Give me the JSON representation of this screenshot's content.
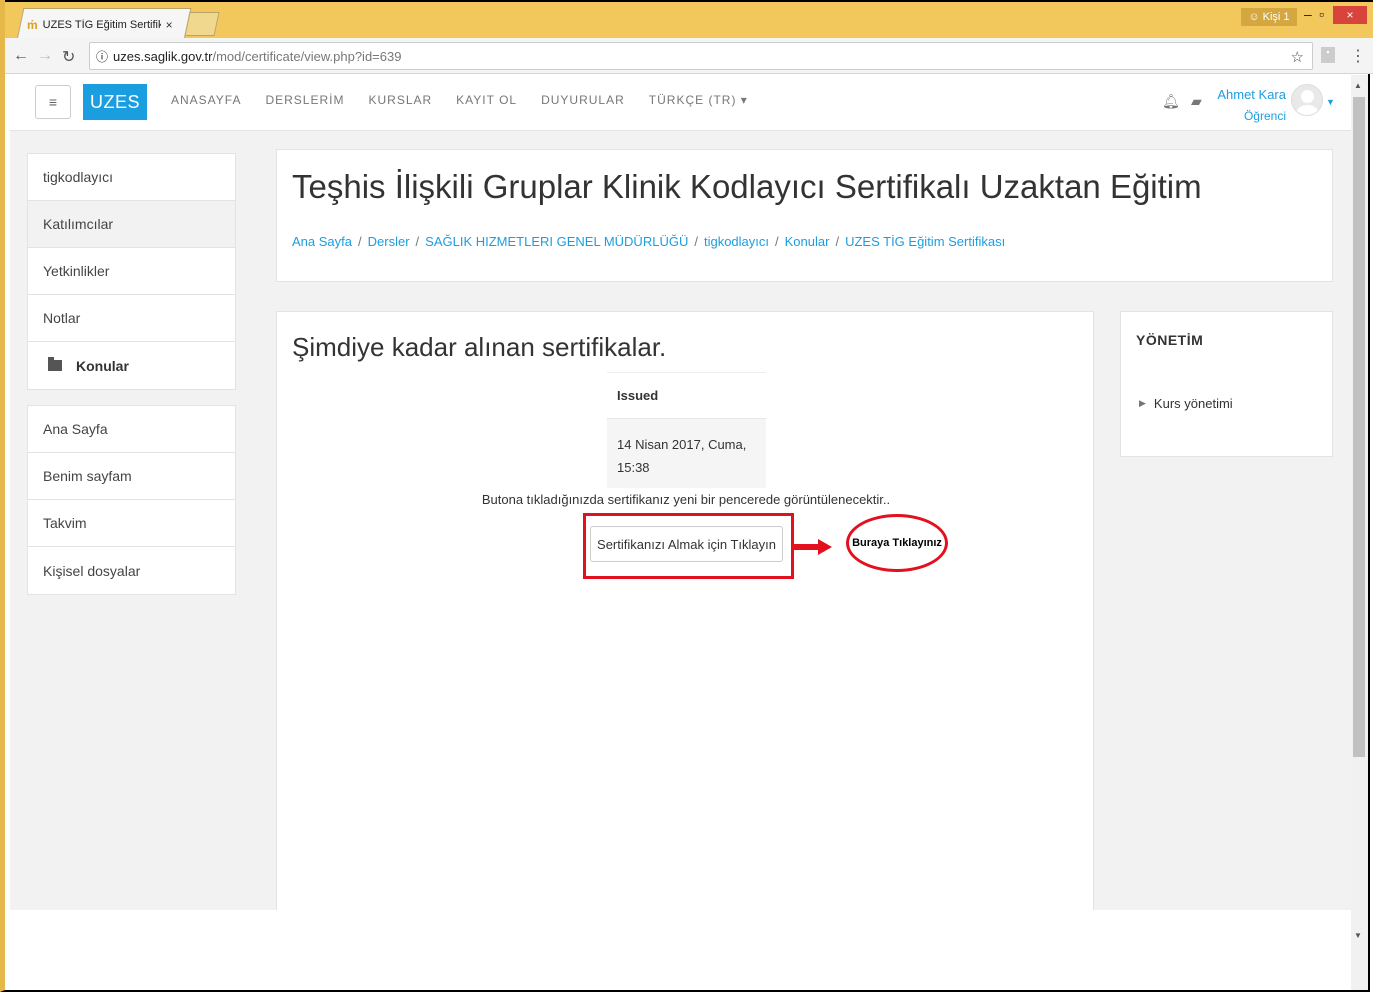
{
  "browser": {
    "tab_title": "UZES TİG Eğitim Sertifika",
    "tab_close": "×",
    "profile_label": "Kişi 1",
    "url_host": "uzes.saglik.gov.tr",
    "url_path": "/mod/certificate/view.php?id=639",
    "win_min": "–",
    "win_max": "▫",
    "win_close": "×"
  },
  "navbar": {
    "menu_icon": "≡",
    "brand": "UZES",
    "links": [
      "ANASAYFA",
      "DERSLERİM",
      "KURSLAR",
      "KAYIT OL",
      "DUYURULAR",
      "TÜRKÇE (TR) ▾"
    ],
    "user_name": "Ahmet Kara",
    "user_role": "Öğrenci"
  },
  "left_nav": {
    "course_block": [
      "tigkodlayıcı",
      "Katılımcılar",
      "Yetkinlikler",
      "Notlar",
      "Konular"
    ],
    "site_block": [
      "Ana Sayfa",
      "Benim sayfam",
      "Takvim",
      "Kişisel dosyalar"
    ]
  },
  "header": {
    "title": "Teşhis İlişkili Gruplar Klinik Kodlayıcı Sertifikalı Uzaktan Eğitim",
    "breadcrumb": [
      "Ana Sayfa",
      "Dersler",
      "SAĞLIK HIZMETLERI GENEL MÜDÜRLÜĞÜ",
      "tigkodlayıcı",
      "Konular",
      "UZES TİG Eğitim Sertifikası"
    ],
    "separator": "/"
  },
  "main": {
    "heading": "Şimdiye kadar alınan sertifikalar.",
    "table_header": "Issued",
    "issued_date_line1": "14 Nisan 2017, Cuma,",
    "issued_date_line2": "15:38",
    "info_text": "Butona tıkladığınızda sertifikanız yeni bir pencerede görüntülenecektir..",
    "button_label": "Sertifikanızı Almak için Tıklayın",
    "callout_label": "Buraya Tıklayınız",
    "highlight_color": "#e3101d"
  },
  "sidebar_right": {
    "title": "YÖNETİM",
    "item": "Kurs yönetimi"
  },
  "colors": {
    "brand": "#1b9ee0",
    "titlebar": "#f2c75c"
  }
}
